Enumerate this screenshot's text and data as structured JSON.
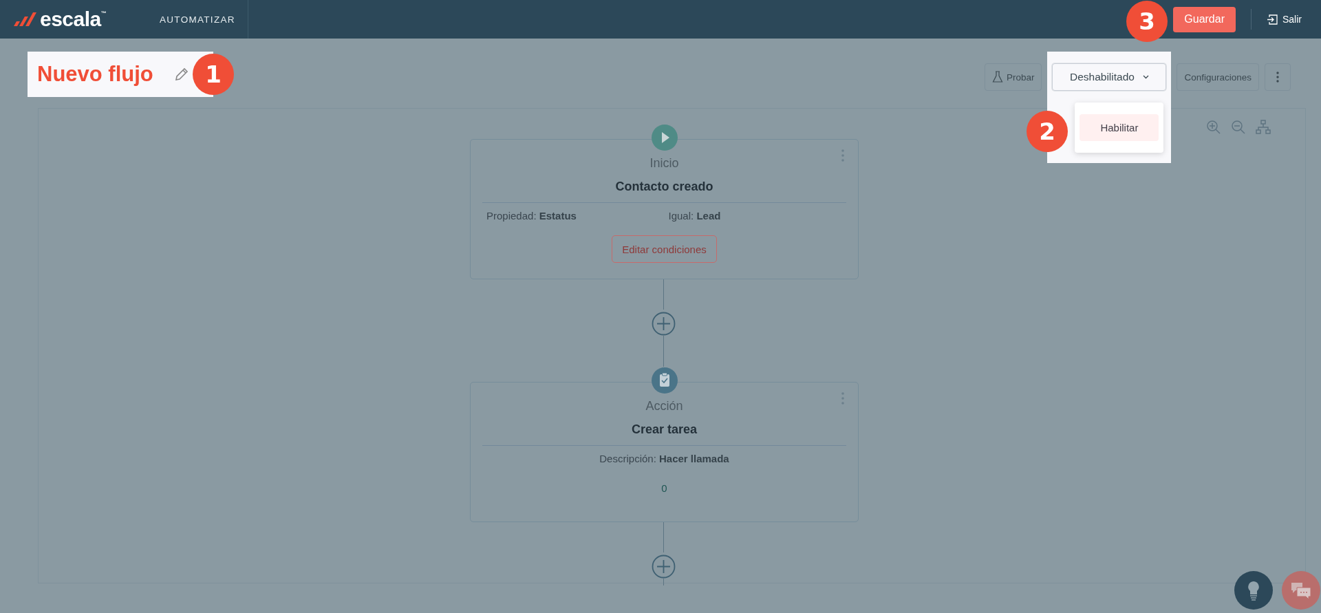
{
  "header": {
    "brand": "escala",
    "trademark": "™",
    "section": "AUTOMATIZAR",
    "save_button": "Guardar",
    "exit_link": "Salir"
  },
  "flow": {
    "title": "Nuevo flujo"
  },
  "toolbar": {
    "test_button": "Probar",
    "status_dropdown": {
      "value": "Deshabilitado",
      "expanded": true,
      "options": [
        {
          "label": "Habilitar",
          "selected": true
        }
      ]
    },
    "settings_button": "Configuraciones"
  },
  "nodes": [
    {
      "kind": "trigger",
      "type_label": "Inicio",
      "title": "Contacto creado",
      "details": [
        {
          "label": "Propiedad:",
          "value": "Estatus"
        },
        {
          "label": "Igual:",
          "value": "Lead"
        }
      ],
      "button": "Editar condiciones"
    },
    {
      "kind": "action",
      "type_label": "Acción",
      "title": "Crear tarea",
      "details": [
        {
          "label": "Descripción:",
          "value": "Hacer llamada"
        }
      ],
      "count": "0"
    }
  ],
  "callouts": [
    {
      "number": "1"
    },
    {
      "number": "2"
    },
    {
      "number": "3"
    }
  ]
}
